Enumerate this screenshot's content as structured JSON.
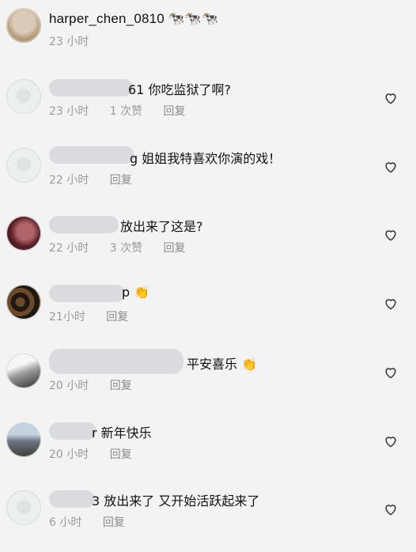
{
  "post": {
    "username": "harper_chen_0810",
    "username_emoji": "🐄🐄🐄",
    "time": "23 小时"
  },
  "comments": [
    {
      "text": "61 你吃监狱了啊?",
      "time": "23 小时",
      "likes": "1 次赞",
      "reply": "回复"
    },
    {
      "text": "g 姐姐我特喜欢你演的戏！",
      "time": "22 小时",
      "likes": "",
      "reply": "回复"
    },
    {
      "text": "放出来了这是?",
      "time": "22 小时",
      "likes": "3 次赞",
      "reply": "回复"
    },
    {
      "text": "p 👏",
      "time": "21小时",
      "likes": "",
      "reply": "回复"
    },
    {
      "text": "平安喜乐 👏",
      "time": "20 小时",
      "likes": "",
      "reply": "回复"
    },
    {
      "text": "r 新年快乐",
      "time": "20 小时",
      "likes": "",
      "reply": "回复"
    },
    {
      "text": "3 放出来了  又开始活跃起来了",
      "time": "6 小时",
      "likes": "",
      "reply": "回复"
    }
  ]
}
